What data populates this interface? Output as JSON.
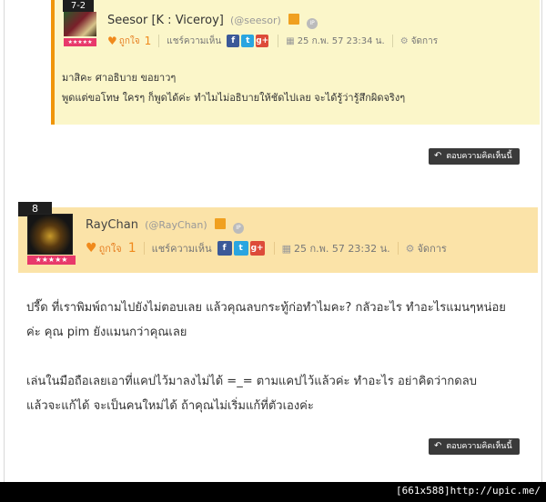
{
  "reply": {
    "number": "7-2",
    "author_name": "Seesor [K : Viceroy]",
    "author_handle": "(@seesor)",
    "rank_stars": "★★★★★",
    "like_label": "ถูกใจ",
    "like_count": "1",
    "share_label": "แชร์ความเห็น",
    "date": "25 ก.พ. 57 23:34 น.",
    "manage_label": "จัดการ",
    "text_lines": [
      "มาสิคะ ศาอธิบาย ขอยาวๆ",
      "พูดแต่ขอโทษ ใครๆ ก็พูดได้ค่ะ ทำไมไม่อธิบายให้ชัดไปเลย จะได้รู้ว่ารู้สึกผิดจริงๆ"
    ],
    "reply_button": "ตอบความคิดเห็นนี้"
  },
  "post": {
    "number": "8",
    "author_name": "RayChan",
    "author_handle": "(@RayChan)",
    "rank_stars": "★★★★★",
    "like_label": "ถูกใจ",
    "like_count": "1",
    "share_label": "แชร์ความเห็น",
    "date": "25 ก.พ. 57 23:32 น.",
    "manage_label": "จัดการ",
    "paragraphs": [
      [
        "ปรี๊ด ที่เราพิมพ์ถามไปยังไม่ตอบเลย แล้วคุณลบกระทู้ก่อทำไมคะ? กลัวอะไร ทำอะไรแมนๆหน่อย",
        "ค่ะ คุณ pim ยังแมนกว่าคุณเลย"
      ],
      [
        "เล่นในมือถือเลยเอาที่แคปไว้มาลงไม่ได้ =_= ตามแคปไว้แล้วค่ะ ทำอะไร อย่าคิดว่ากดลบ",
        "แล้วจะแก้ได้ จะเป็นคนใหม่ได้ ถ้าคุณไม่เริ่มแก้ที่ตัวเองค่ะ"
      ]
    ],
    "reply_button": "ตอบความคิดเห็นนี้"
  },
  "footer": {
    "text": "[661x588]http://upic.me/"
  },
  "icons": {
    "heart": "♥",
    "calendar": "▦",
    "gear": "⚙",
    "reply_arrow": "↶",
    "facebook": "f",
    "twitter": "t",
    "gplus": "g+",
    "ip": "IP"
  },
  "colors": {
    "reply_bg": "#fbf6c9",
    "reply_accent": "#f0950a",
    "post_header_bg": "#fbe3a8",
    "rank_bar": "#e8396b",
    "button_bg": "#3a3a3a"
  }
}
